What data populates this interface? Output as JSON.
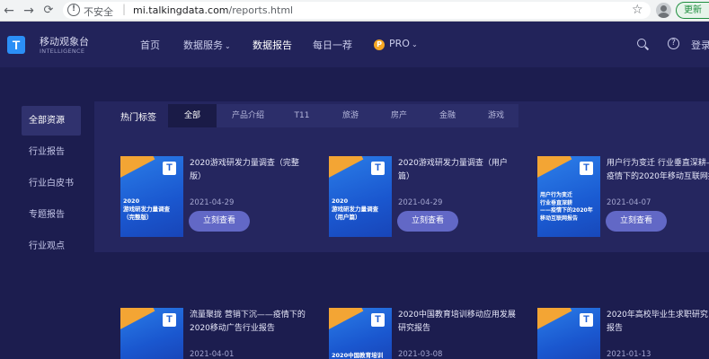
{
  "browser": {
    "back": "←",
    "forward": "→",
    "reload": "C",
    "home": "⌂",
    "warn": "!",
    "insecure": "不安全",
    "separator": "|",
    "url_domain": "mi.talkingdata.com",
    "url_path": "/reports.html",
    "star": "☆",
    "update_label": "更新"
  },
  "header": {
    "logo_mark": "T",
    "logo_cn": "移动观象台",
    "logo_en": "INTELLIGENCE",
    "nav": [
      {
        "label": "首页"
      },
      {
        "label": "数据服务"
      },
      {
        "label": "数据报告"
      },
      {
        "label": "每日一荐"
      },
      {
        "label": "PRO"
      }
    ],
    "chevron": "⌄",
    "pro_badge": "P",
    "help": "?",
    "login": "登录"
  },
  "sidebar": {
    "items": [
      {
        "label": "全部资源"
      },
      {
        "label": "行业报告"
      },
      {
        "label": "行业白皮书"
      },
      {
        "label": "专题报告"
      },
      {
        "label": "行业观点"
      }
    ]
  },
  "tags": {
    "label": "热门标签",
    "items": [
      {
        "label": "全部"
      },
      {
        "label": "产品介绍"
      },
      {
        "label": "T11"
      },
      {
        "label": "旅游"
      },
      {
        "label": "房产"
      },
      {
        "label": "金融"
      },
      {
        "label": "游戏"
      }
    ]
  },
  "reports": [
    {
      "cover_logo": "T",
      "cover_text": "2020\n游戏研发力量调查\n（完整版）",
      "title": "2020游戏研发力量调查（完整\n版）",
      "date": "2021-04-29",
      "button": "立刻查看"
    },
    {
      "cover_logo": "T",
      "cover_text": "2020\n游戏研发力量调查\n（用户篇）",
      "title": "2020游戏研发力量调查（用户\n篇）",
      "date": "2021-04-29",
      "button": "立刻查看"
    },
    {
      "cover_logo": "T",
      "cover_text": "用户行为变迁\n行业垂直深耕\n——疫情下的2020年\n移动互联网报告",
      "title": "用户行为变迁 行业垂直深耕——\n疫情下的2020年移动互联网报告",
      "date": "2021-04-07",
      "button": "立刻查看"
    }
  ],
  "reports_bottom": [
    {
      "cover_logo": "T",
      "title": "流量聚拢 营销下沉——疫情下的\n2020移动广告行业报告",
      "date": "2021-04-01"
    },
    {
      "cover_logo": "T",
      "cover_text": "2020中国教育培训",
      "title": "2020中国教育培训移动应用发展\n研究报告",
      "date": "2021-03-08"
    },
    {
      "cover_logo": "T",
      "title": "2020年高校毕业生求职研究报告",
      "date": "2021-01-13"
    }
  ],
  "colors": {
    "page_bg": "#1c1d4f",
    "header_bg": "#22235a",
    "panel_bg": "#25265f",
    "button": "#6268c6",
    "cover_blue": "#1a57cf",
    "cover_accent": "#f3a534",
    "logo_blue": "#2b8ff6"
  },
  "icons": {
    "search": "search-icon",
    "help": "help-icon",
    "star": "star-icon",
    "profile": "profile-icon"
  }
}
